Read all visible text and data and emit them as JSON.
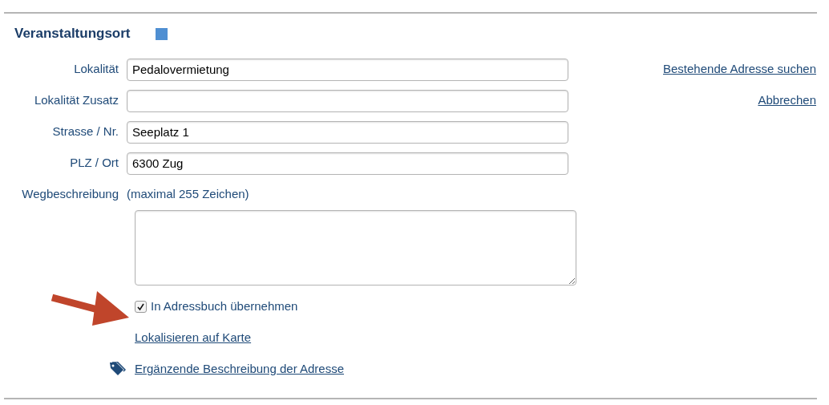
{
  "section": {
    "title": "Veranstaltungsort"
  },
  "fields": [
    {
      "label": "Lokalität",
      "value": "Pedalovermietung",
      "side_link": "Bestehende Adresse suchen"
    },
    {
      "label": "Lokalität Zusatz",
      "side_link": "Abbrechen"
    },
    {
      "label": "Strasse / Nr.",
      "value": "Seeplatz 1"
    },
    {
      "label": "PLZ / Ort",
      "value": "6300 Zug"
    }
  ],
  "directions": {
    "label": "Wegbeschreibung",
    "hint": "(maximal 255 Zeichen)"
  },
  "checkbox": {
    "label": "In Adressbuch übernehmen",
    "checked": true
  },
  "links": [
    {
      "text": "Lokalisieren auf Karte",
      "kind": "plain"
    },
    {
      "text": "Ergänzende Beschreibung der Adresse",
      "kind": "tag"
    }
  ]
}
